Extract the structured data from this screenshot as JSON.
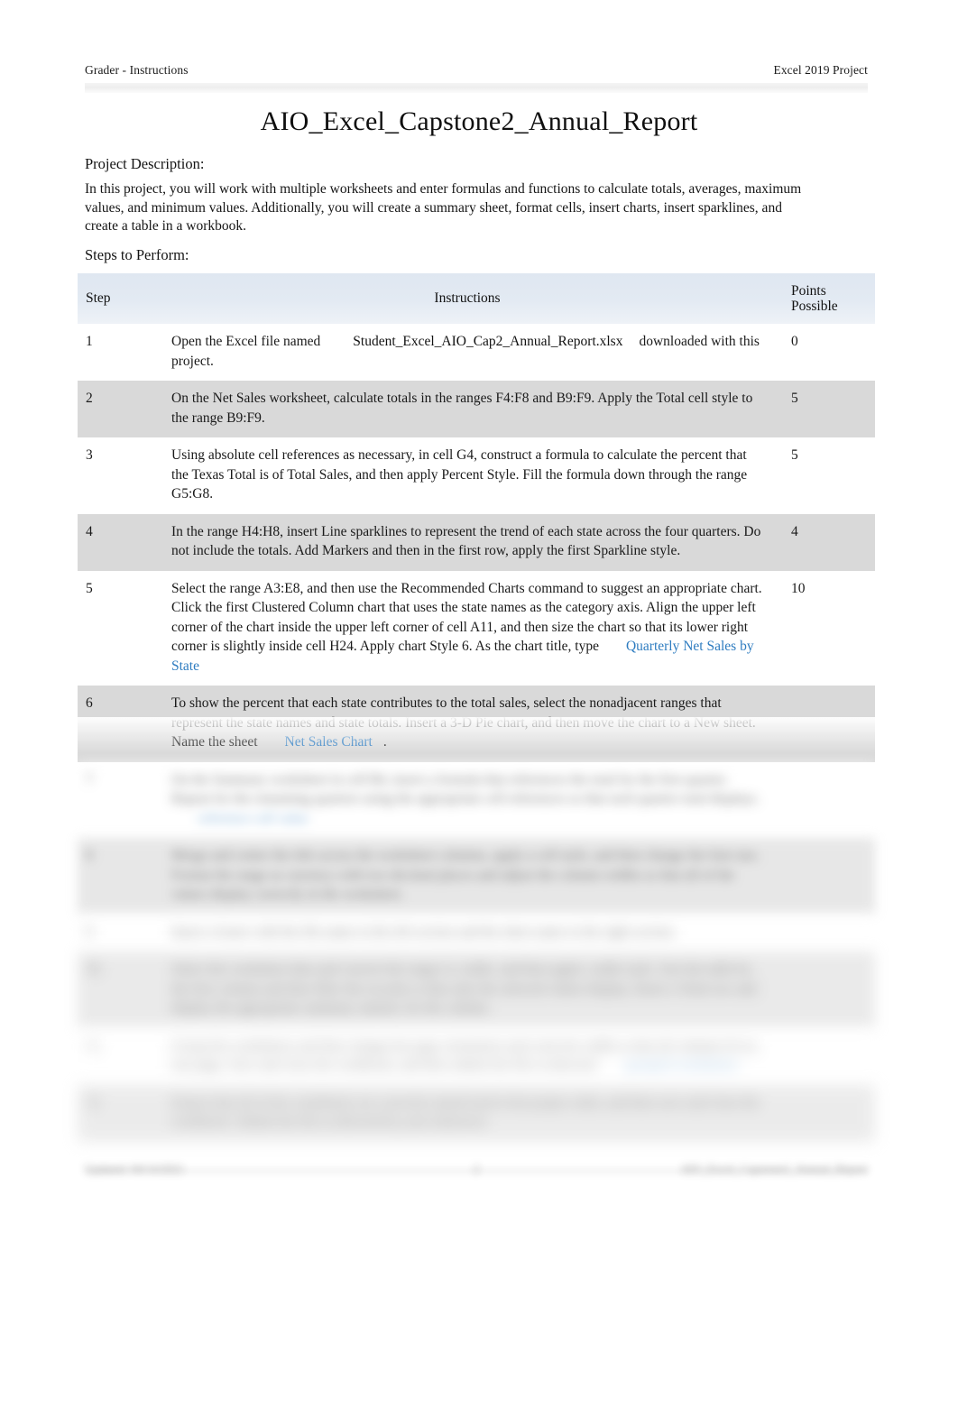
{
  "header": {
    "left": "Grader - Instructions",
    "right": "Excel 2019 Project"
  },
  "title": "AIO_Excel_Capstone2_Annual_Report",
  "sections": {
    "description_label": "Project Description:",
    "description_body": "In this project, you will work with multiple worksheets and enter formulas and functions to calculate totals, averages, maximum values, and minimum values. Additionally, you will create a summary sheet, format cells, insert charts, insert sparklines, and create a table in a workbook.",
    "steps_label": "Steps to Perform:"
  },
  "table": {
    "columns": {
      "step": "Step",
      "instructions": "Instructions",
      "points_line1": "Points",
      "points_line2": "Possible"
    },
    "rows": [
      {
        "step": "1",
        "points": "0",
        "shaded": false,
        "blurred": false,
        "text_before": "Open the Excel file named",
        "filename": "Student_Excel_AIO_Cap2_Annual_Report.xlsx",
        "text_after": "downloaded with this project."
      },
      {
        "step": "2",
        "points": "5",
        "shaded": true,
        "blurred": false,
        "text": "On the Net Sales worksheet, calculate totals in the ranges F4:F8 and B9:F9. Apply the Total cell style to the range B9:F9."
      },
      {
        "step": "3",
        "points": "5",
        "shaded": false,
        "blurred": false,
        "text": "Using absolute cell references as necessary, in cell G4, construct a formula to calculate the percent that the Texas Total is of Total Sales, and then apply Percent Style. Fill the formula down through the range G5:G8."
      },
      {
        "step": "4",
        "points": "4",
        "shaded": true,
        "blurred": false,
        "text": "In the range H4:H8, insert Line sparklines to represent the trend of each state across the four quarters. Do not include the totals. Add Markers and then in the first row, apply the first Sparkline style."
      },
      {
        "step": "5",
        "points": "10",
        "shaded": false,
        "blurred": false,
        "text": "Select the range A3:E8, and then use the Recommended Charts command to suggest an appropriate chart. Click the first Clustered Column chart that uses the state names as the category axis. Align the upper left corner of the chart inside the upper left corner of cell A11, and then size the chart so that its lower right corner is slightly inside cell H24. Apply chart Style 6. As the chart title, type",
        "highlight": "Quarterly Net Sales by State",
        "text_tail": ""
      },
      {
        "step": "6",
        "points": "",
        "shaded": true,
        "blurred": false,
        "text": "To show the percent that each state contributes to the total sales, select the nonadjacent ranges that represent the state names and state totals. Insert a 3-D Pie chart, and then move the chart to a New sheet. Name the sheet",
        "highlight": "Net Sales Chart",
        "text_tail": "."
      },
      {
        "step": "7",
        "points": "",
        "shaded": false,
        "blurred": true,
        "text": "On the Summary worksheet in cell B4, insert a formula that references the total for the first quarter. Repeat for the remaining quarters using the appropriate cell references so that each quarter total displays.",
        "highlight": "reference cell value",
        "text_tail": ""
      },
      {
        "step": "8",
        "points": "",
        "shaded": true,
        "blurred": true,
        "text": "Merge and center the title across the worksheet columns, apply a cell style, and then change the font size. Format the range as currency with two decimal places and adjust the column widths so that all of the values display correctly in the worksheet."
      },
      {
        "step": "9",
        "points": "",
        "shaded": false,
        "blurred": true,
        "text": "Insert a footer with the file name in the left section and the sheet name in the right section."
      },
      {
        "step": "10",
        "points": "",
        "shaded": true,
        "blurred": true,
        "text": "Select the worksheet data and convert the range to a table, and then apply a table style. Sort the table by the first column and then filter the records so that only the selected values display. Insert a Total row and display the appropriate summary statistic for the column."
      },
      {
        "step": "11",
        "points": "",
        "shaded": false,
        "blurred": true,
        "text": "Group the worksheets and then change the page orientation and scale the width so that all columns fit on one page. Save and close the workbook, and then submit the file as directed.",
        "highlight": "grouped worksheets"
      },
      {
        "step": "12",
        "points": "",
        "shaded": true,
        "blurred": true,
        "text": "Ensure that all of the worksheets are correctly named and in the proper order, and then save and close the workbook. Submit the file as directed by your instructor."
      }
    ]
  },
  "footer": {
    "left": "Updated: 04/14/2021",
    "center": "2",
    "right": "AIO_Excel_Capstone2_Annual_Report"
  }
}
